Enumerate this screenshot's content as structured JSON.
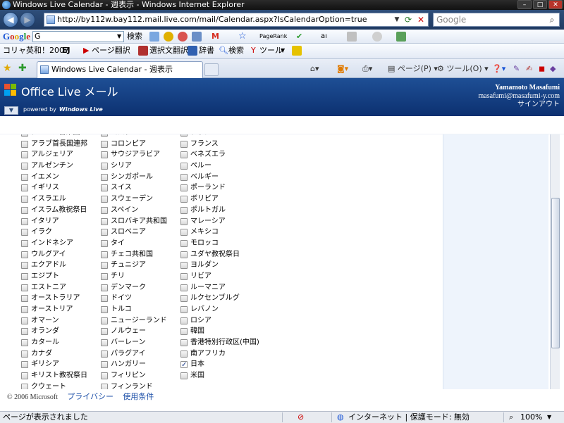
{
  "window": {
    "title": "Windows Live Calendar - 週表示 - Windows Internet Explorer"
  },
  "address": {
    "url": "http://by112w.bay112.mail.live.com/mail/Calendar.aspx?IsCalendarOption=true",
    "search_placeholder": "Google"
  },
  "toolbar1": {
    "google_search_button": "検索",
    "pagerank_label": "PageRank",
    "gbox_value": "G"
  },
  "toolbar2": {
    "corea_label": "コリャ英和！2007",
    "ej_label": "EJ",
    "page_translate": "ページ翻訳",
    "selected_translate": "選択文翻訳",
    "dictionary": "辞書",
    "search": "検索",
    "tools": "ツール"
  },
  "tabs": {
    "active_tab": "Windows Live Calendar - 週表示",
    "page_menu": "ページ(P)",
    "tools_menu": "ツール(O)"
  },
  "header": {
    "brand": "Office Live メール",
    "powered_by": "powered by",
    "windows_live": "Windows Live",
    "user_name": "Yamamoto Masafumi",
    "user_email": "masafumi@masafumi-y.com",
    "signout": "サインアウト"
  },
  "holidays": {
    "col1": [
      {
        "label": "アメリカ合衆国",
        "checked": false
      },
      {
        "label": "アラブ首長国連邦",
        "checked": false
      },
      {
        "label": "アルジェリア",
        "checked": false
      },
      {
        "label": "アルゼンチン",
        "checked": false
      },
      {
        "label": "イエメン",
        "checked": false
      },
      {
        "label": "イギリス",
        "checked": false
      },
      {
        "label": "イスラエル",
        "checked": false
      },
      {
        "label": "イスラム教祝祭日",
        "checked": false
      },
      {
        "label": "イタリア",
        "checked": false
      },
      {
        "label": "イラク",
        "checked": false
      },
      {
        "label": "インドネシア",
        "checked": false
      },
      {
        "label": "ウルグアイ",
        "checked": false
      },
      {
        "label": "エクアドル",
        "checked": false
      },
      {
        "label": "エジプト",
        "checked": false
      },
      {
        "label": "エストニア",
        "checked": false
      },
      {
        "label": "オーストラリア",
        "checked": false
      },
      {
        "label": "オーストリア",
        "checked": false
      },
      {
        "label": "オマーン",
        "checked": false
      },
      {
        "label": "オランダ",
        "checked": false
      },
      {
        "label": "カタール",
        "checked": false
      },
      {
        "label": "カナダ",
        "checked": false
      },
      {
        "label": "ギリシア",
        "checked": false
      },
      {
        "label": "キリスト教祝祭日",
        "checked": false
      },
      {
        "label": "クウェート",
        "checked": false
      }
    ],
    "col2": [
      {
        "label": "コスタリカ",
        "checked": false
      },
      {
        "label": "コロンビア",
        "checked": false
      },
      {
        "label": "サウジアラビア",
        "checked": false
      },
      {
        "label": "シリア",
        "checked": false
      },
      {
        "label": "シンガポール",
        "checked": false
      },
      {
        "label": "スイス",
        "checked": false
      },
      {
        "label": "スウェーデン",
        "checked": false
      },
      {
        "label": "スペイン",
        "checked": false
      },
      {
        "label": "スロバキア共和国",
        "checked": false
      },
      {
        "label": "スロベニア",
        "checked": false
      },
      {
        "label": "タイ",
        "checked": false
      },
      {
        "label": "チェコ共和国",
        "checked": false
      },
      {
        "label": "チュニジア",
        "checked": false
      },
      {
        "label": "チリ",
        "checked": false
      },
      {
        "label": "デンマーク",
        "checked": false
      },
      {
        "label": "ドイツ",
        "checked": false
      },
      {
        "label": "トルコ",
        "checked": false
      },
      {
        "label": "ニュージーランド",
        "checked": false
      },
      {
        "label": "ノルウェー",
        "checked": false
      },
      {
        "label": "バーレーン",
        "checked": false
      },
      {
        "label": "パラグアイ",
        "checked": false
      },
      {
        "label": "ハンガリー",
        "checked": false
      },
      {
        "label": "フィリピン",
        "checked": false
      },
      {
        "label": "フィンランド",
        "checked": false
      }
    ],
    "col3": [
      {
        "label": "ブラジル",
        "checked": false
      },
      {
        "label": "フランス",
        "checked": false
      },
      {
        "label": "ベネズエラ",
        "checked": false
      },
      {
        "label": "ペルー",
        "checked": false
      },
      {
        "label": "ベルギー",
        "checked": false
      },
      {
        "label": "ポーランド",
        "checked": false
      },
      {
        "label": "ボリビア",
        "checked": false
      },
      {
        "label": "ポルトガル",
        "checked": false
      },
      {
        "label": "マレーシア",
        "checked": false
      },
      {
        "label": "メキシコ",
        "checked": false
      },
      {
        "label": "モロッコ",
        "checked": false
      },
      {
        "label": "ユダヤ教祝祭日",
        "checked": false
      },
      {
        "label": "ヨルダン",
        "checked": false
      },
      {
        "label": "リビア",
        "checked": false
      },
      {
        "label": "ルーマニア",
        "checked": false
      },
      {
        "label": "ルクセンブルグ",
        "checked": false
      },
      {
        "label": "レバノン",
        "checked": false
      },
      {
        "label": "ロシア",
        "checked": false
      },
      {
        "label": "韓国",
        "checked": false
      },
      {
        "label": "香港特別行政区(中国)",
        "checked": false
      },
      {
        "label": "南アフリカ",
        "checked": false
      },
      {
        "label": "日本",
        "checked": true
      },
      {
        "label": "米国",
        "checked": false
      }
    ]
  },
  "footer": {
    "copyright": "© 2006 Microsoft",
    "privacy": "プライバシー",
    "terms": "使用条件"
  },
  "status": {
    "text": "ページが表示されました",
    "zone": "インターネット | 保護モード: 無効",
    "zoom": "100%"
  }
}
